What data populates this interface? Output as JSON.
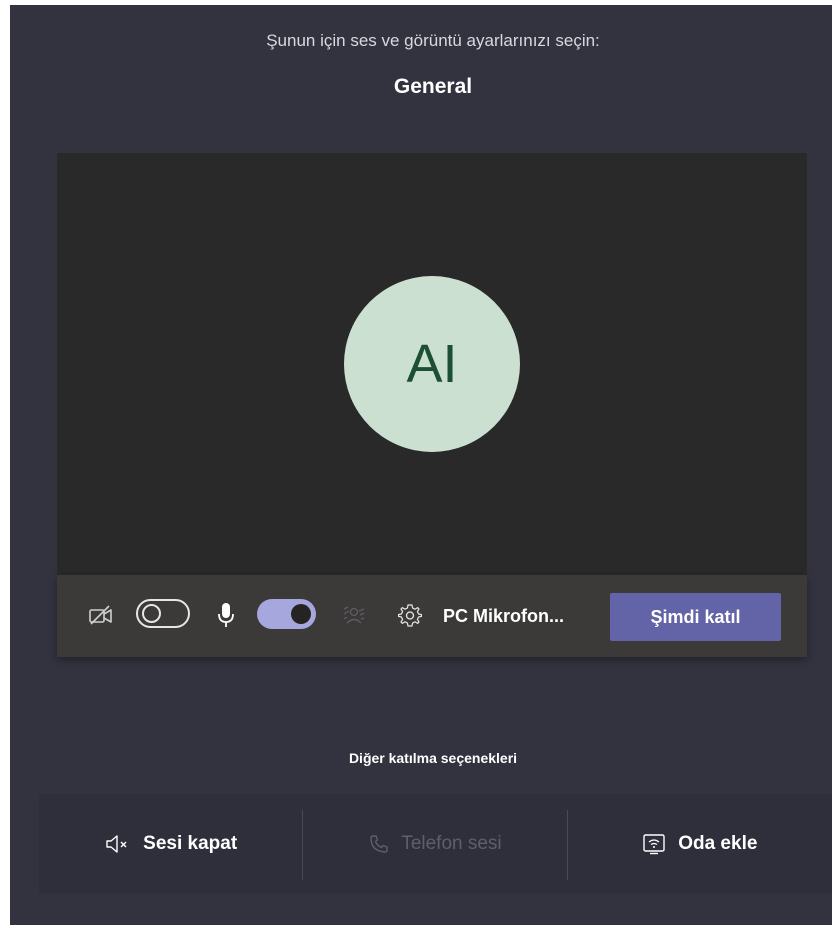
{
  "header": {
    "subtitle": "Şunun için ses ve görüntü ayarlarınızı seçin:",
    "title": "General"
  },
  "preview": {
    "avatar_initials": "AI",
    "avatar_bg": "#cce0d2",
    "avatar_fg": "#1c4f33"
  },
  "controls": {
    "camera_toggle": "off",
    "mic_toggle": "on",
    "device_label": "PC Mikrofon...",
    "join_label": "Şimdi katıl",
    "accent": "#6264a7"
  },
  "other_options": {
    "heading": "Diğer katılma seçenekleri",
    "items": [
      {
        "label": "Sesi kapat",
        "icon": "speaker-mute-icon",
        "enabled": true
      },
      {
        "label": "Telefon sesi",
        "icon": "phone-icon",
        "enabled": false
      },
      {
        "label": "Oda ekle",
        "icon": "cast-room-icon",
        "enabled": true
      }
    ]
  }
}
